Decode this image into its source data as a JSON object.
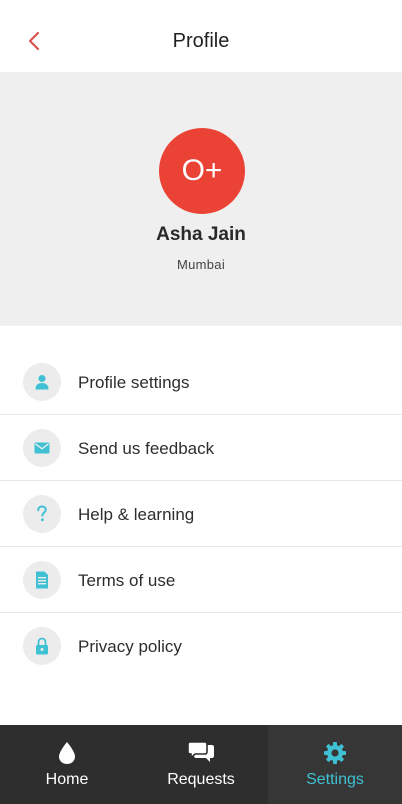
{
  "header": {
    "title": "Profile"
  },
  "profile": {
    "blood_group": "O+",
    "name": "Asha Jain",
    "city": "Mumbai"
  },
  "menu": {
    "items": [
      {
        "label": "Profile settings",
        "icon": "person-icon"
      },
      {
        "label": "Send us feedback",
        "icon": "envelope-icon"
      },
      {
        "label": "Help & learning",
        "icon": "question-icon"
      },
      {
        "label": "Terms of use",
        "icon": "document-icon"
      },
      {
        "label": "Privacy policy",
        "icon": "lock-icon"
      }
    ]
  },
  "tabs": [
    {
      "label": "Home",
      "icon": "drop-icon",
      "active": false
    },
    {
      "label": "Requests",
      "icon": "chat-bubbles-icon",
      "active": false
    },
    {
      "label": "Settings",
      "icon": "gear-icon",
      "active": true
    }
  ],
  "colors": {
    "accent": "#3fc1d3",
    "avatar": "#ea4335",
    "back_arrow": "#d9534f",
    "tabbar": "#2e2e2e",
    "panel": "#efefef"
  }
}
